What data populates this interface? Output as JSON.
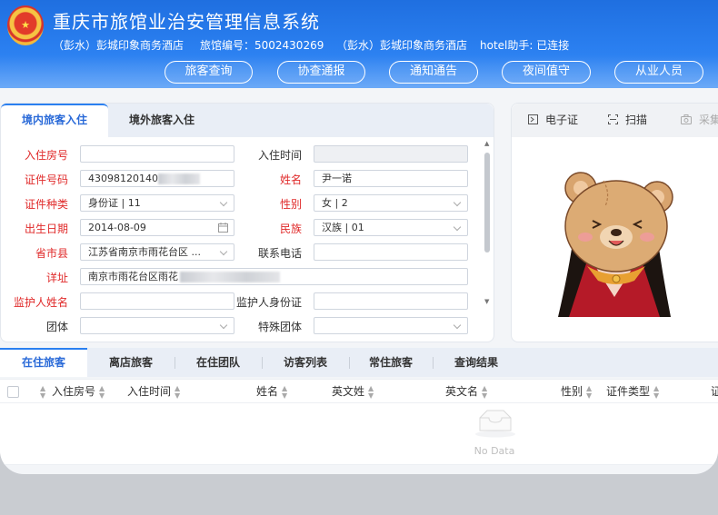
{
  "header": {
    "title": "重庆市旅馆业治安管理信息系统",
    "location": "（彭水）彭城印象商务酒店",
    "hotel_no_label": "旅馆编号：5002430269",
    "location2": "（彭水）彭城印象商务酒店",
    "helper_status": "hotel助手: 已连接",
    "nav": [
      "旅客查询",
      "协查通报",
      "通知通告",
      "夜间值守",
      "从业人员"
    ]
  },
  "checkin_tabs": [
    "境内旅客入住",
    "境外旅客入住"
  ],
  "form": {
    "room_no": {
      "label": "入住房号",
      "value": ""
    },
    "checkin_time": {
      "label": "入住时间",
      "value": ""
    },
    "id_no": {
      "label": "证件号码",
      "value": "43098120140"
    },
    "name": {
      "label": "姓名",
      "value": "尹一诺"
    },
    "id_type": {
      "label": "证件种类",
      "value": "身份证 | 11"
    },
    "gender": {
      "label": "性别",
      "value": "女 | 2"
    },
    "birth": {
      "label": "出生日期",
      "value": "2014-08-09"
    },
    "ethnicity": {
      "label": "民族",
      "value": "汉族 | 01"
    },
    "region": {
      "label": "省市县",
      "value": "江苏省南京市雨花台区 ..."
    },
    "phone": {
      "label": "联系电话",
      "value": ""
    },
    "address": {
      "label": "详址",
      "value": "南京市雨花台区雨花"
    },
    "guardian_name": {
      "label": "监护人姓名",
      "value": ""
    },
    "guardian_id": {
      "label": "监护人身份证",
      "value": ""
    },
    "group": {
      "label": "团体",
      "value": ""
    },
    "special_group": {
      "label": "特殊团体",
      "value": ""
    }
  },
  "photo_tabs": [
    "电子证",
    "扫描",
    "采集"
  ],
  "list_tabs": [
    "在住旅客",
    "离店旅客",
    "在住团队",
    "访客列表",
    "常住旅客",
    "查询结果"
  ],
  "table": {
    "columns": [
      "入住房号",
      "入住时间",
      "姓名",
      "英文姓",
      "英文名",
      "性别",
      "证件类型",
      "证"
    ],
    "empty_text": "No Data"
  },
  "colors": {
    "accent": "#2a7ff0",
    "required": "#e02a2a"
  }
}
